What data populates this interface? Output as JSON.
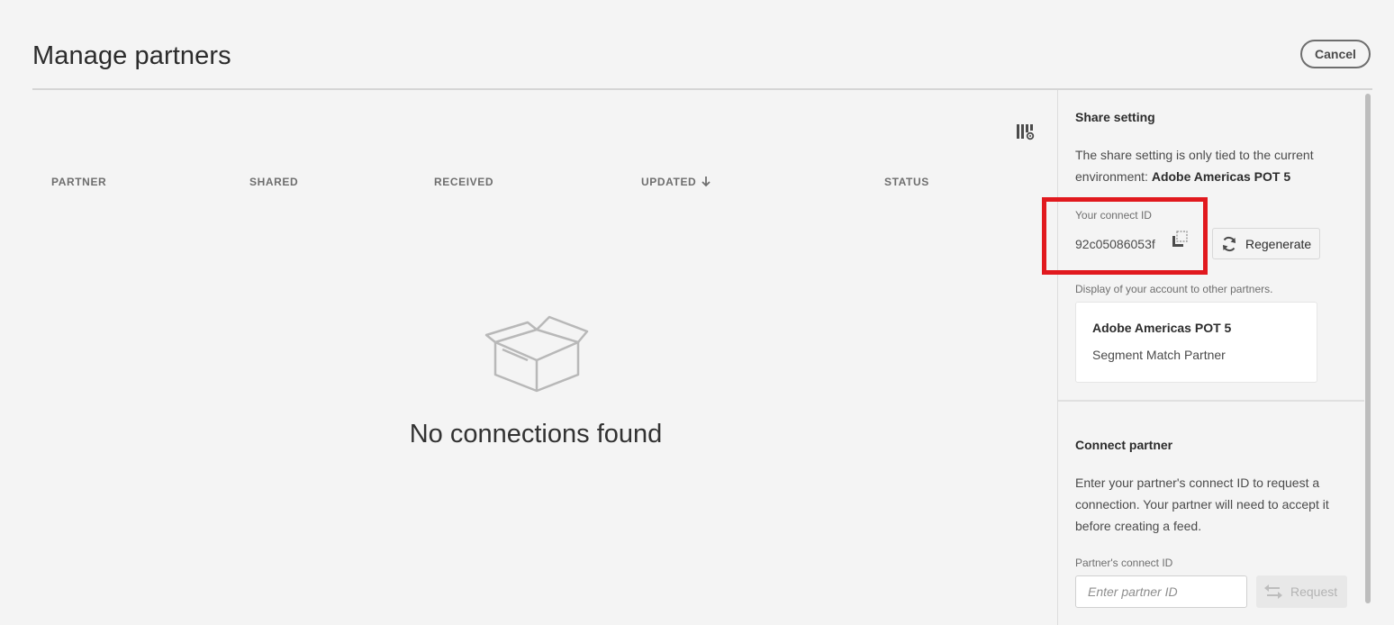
{
  "header": {
    "title": "Manage partners",
    "cancel_label": "Cancel"
  },
  "table": {
    "columns": [
      "PARTNER",
      "SHARED",
      "RECEIVED",
      "UPDATED",
      "STATUS"
    ],
    "sorted_column": "UPDATED",
    "sort_direction": "descending",
    "empty_message": "No connections found"
  },
  "share_setting": {
    "heading": "Share setting",
    "description_prefix": "The share setting is only tied to the current environment: ",
    "environment": "Adobe Americas POT 5",
    "connect_id_label": "Your connect ID",
    "connect_id": "92c05086053f",
    "regenerate_label": "Regenerate",
    "display_label": "Display of your account to other partners.",
    "account_name": "Adobe Americas POT 5",
    "account_role": "Segment Match Partner"
  },
  "connect_partner": {
    "heading": "Connect partner",
    "description": "Enter your partner's connect ID to request a connection. Your partner will need to accept it before creating a feed.",
    "field_label": "Partner's connect ID",
    "placeholder": "Enter partner ID",
    "request_label": "Request"
  },
  "colors": {
    "highlight": "#e1191e",
    "background": "#f4f4f4"
  }
}
